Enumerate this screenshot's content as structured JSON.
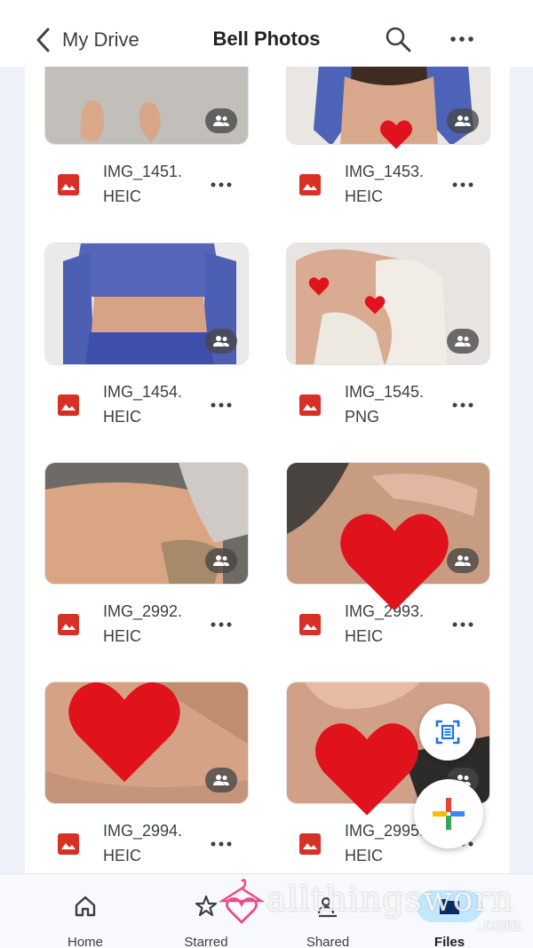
{
  "header": {
    "back_label": "My Drive",
    "title": "Bell Photos"
  },
  "files": [
    {
      "name_line1": "IMG_1451.",
      "name_line2": "HEIC",
      "thumb": "feet-carpet"
    },
    {
      "name_line1": "IMG_1453.",
      "name_line2": "HEIC",
      "thumb": "back-blue-top"
    },
    {
      "name_line1": "IMG_1454.",
      "name_line2": "HEIC",
      "thumb": "midriff-blue"
    },
    {
      "name_line1": "IMG_1545.",
      "name_line2": "PNG",
      "thumb": "white-robe"
    },
    {
      "name_line1": "IMG_2992.",
      "name_line2": "HEIC",
      "thumb": "stomach-leopard"
    },
    {
      "name_line1": "IMG_2993.",
      "name_line2": "HEIC",
      "thumb": "hand-skin"
    },
    {
      "name_line1": "IMG_2994.",
      "name_line2": "HEIC",
      "thumb": "skin-closeup"
    },
    {
      "name_line1": "IMG_2995.",
      "name_line2": "HEIC",
      "thumb": "skin-fingers"
    }
  ],
  "bottom_nav": {
    "home": "Home",
    "starred": "Starred",
    "shared": "Shared",
    "files": "Files"
  },
  "watermark": {
    "text": "allthingsworn",
    "sub": ".com"
  },
  "colors": {
    "file_icon_red": "#d93025",
    "heart_red": "#e0121c",
    "active_pill": "#c2e7ff",
    "nav_background": "#f7f9fc"
  },
  "icons": [
    "chevron-left-icon",
    "search-icon",
    "more-vert-icon",
    "shared-people-icon",
    "image-file-icon",
    "scan-icon",
    "plus-icon",
    "home-icon",
    "star-icon",
    "shared-icon",
    "files-icon",
    "heart-icon"
  ]
}
